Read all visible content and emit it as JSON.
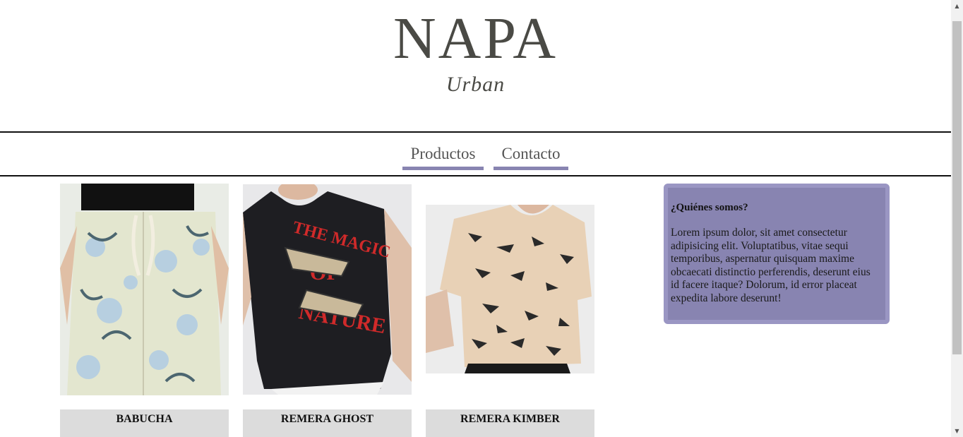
{
  "brand": {
    "name": "NAPA",
    "tagline": "Urban"
  },
  "nav": {
    "items": [
      {
        "label": "Productos"
      },
      {
        "label": "Contacto"
      }
    ],
    "accent_color": "#8884b1"
  },
  "products": [
    {
      "name": "BABUCHA",
      "image": "floral-pants-photo"
    },
    {
      "name": "REMERA GHOST",
      "image": "black-tshirt-photo"
    },
    {
      "name": "REMERA KIMBER",
      "image": "animal-print-tshirt-photo"
    }
  ],
  "about": {
    "title": "¿Quiénes somos?",
    "body": "Lorem ipsum dolor, sit amet consectetur adipisicing elit. Voluptatibus, vitae sequi temporibus, aspernatur quisquam maxime obcaecati distinctio perferendis, deserunt eius id facere itaque? Dolorum, id error placeat expedita labore deserunt!",
    "background": "#8884b1"
  }
}
